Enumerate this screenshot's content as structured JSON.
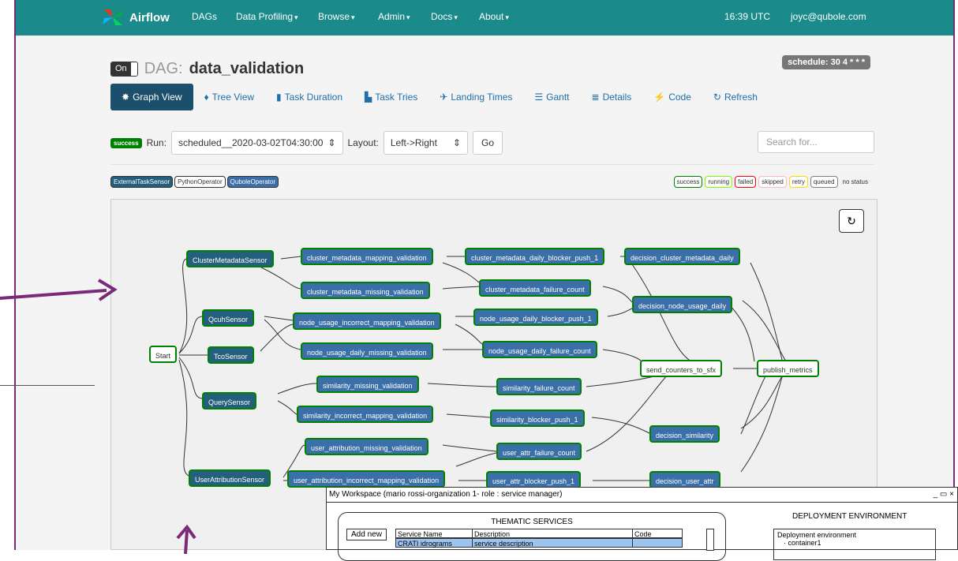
{
  "colors": {
    "navbar": "#1b8a8a",
    "success_border": "#008000",
    "sensor_node": "#255f7e",
    "qubole_node": "#3a6fa8",
    "annotation_arrow": "#7a2a7a"
  },
  "navbar": {
    "brand": "Airflow",
    "items": [
      {
        "label": "DAGs",
        "caret": false
      },
      {
        "label": "Data Profiling",
        "caret": true
      },
      {
        "label": "Browse",
        "caret": true
      },
      {
        "label": "Admin",
        "caret": true
      },
      {
        "label": "Docs",
        "caret": true
      },
      {
        "label": "About",
        "caret": true
      }
    ],
    "time": "16:39 UTC",
    "user": "joyc@qubole.com"
  },
  "header": {
    "toggle": "On",
    "dag_label": "DAG:",
    "dag_id": "data_validation",
    "schedule": "schedule: 30 4 * * *"
  },
  "tabs": [
    {
      "label": "Graph View",
      "icon": "asterisk-icon",
      "active": true
    },
    {
      "label": "Tree View",
      "icon": "tree-icon"
    },
    {
      "label": "Task Duration",
      "icon": "bar-chart-icon"
    },
    {
      "label": "Task Tries",
      "icon": "tries-chart-icon"
    },
    {
      "label": "Landing Times",
      "icon": "plane-icon"
    },
    {
      "label": "Gantt",
      "icon": "gantt-icon"
    },
    {
      "label": "Details",
      "icon": "list-icon"
    },
    {
      "label": "Code",
      "icon": "flash-icon"
    },
    {
      "label": "Refresh",
      "icon": "refresh-icon"
    }
  ],
  "runbar": {
    "status": "success",
    "run_label": "Run:",
    "run_value": "scheduled__2020-03-02T04:30:00",
    "layout_label": "Layout:",
    "layout_value": "Left->Right",
    "go": "Go",
    "search_placeholder": "Search for..."
  },
  "operators": [
    "ExternalTaskSensor",
    "PythonOperator",
    "QuboleOperator"
  ],
  "legend": [
    {
      "label": "success",
      "color": "#008000"
    },
    {
      "label": "running",
      "color": "#7cfc00"
    },
    {
      "label": "failed",
      "color": "#ff0000"
    },
    {
      "label": "skipped",
      "color": "#ffb6c1"
    },
    {
      "label": "retry",
      "color": "#ffd700"
    },
    {
      "label": "queued",
      "color": "#808080"
    },
    {
      "label": "no status",
      "color": null
    }
  ],
  "nodes": {
    "start": "Start",
    "cluster_metadata_sensor": "ClusterMetadataSensor",
    "qcuh_sensor": "QcuhSensor",
    "tco_sensor": "TcoSensor",
    "query_sensor": "QuerySensor",
    "user_attribution_sensor": "UserAttributionSensor",
    "cluster_metadata_mapping_validation": "cluster_metadata_mapping_validation",
    "cluster_metadata_missing_validation": "cluster_metadata_missing_validation",
    "node_usage_incorrect_mapping_validation": "node_usage_incorrect_mapping_validation",
    "node_usage_daily_missing_validation": "node_usage_daily_missing_validation",
    "similarity_missing_validation": "similarity_missing_validation",
    "similarity_incorrect_mapping_validation": "similarity_incorrect_mapping_validation",
    "user_attribution_missing_validation": "user_attribution_missing_validation",
    "user_attribution_incorrect_mapping_validation": "user_attribution_incorrect_mapping_validation",
    "cluster_metadata_daily_blocker_push_1": "cluster_metadata_daily_blocker_push_1",
    "cluster_metadata_failure_count": "cluster_metadata_failure_count",
    "node_usage_daily_blocker_push_1": "node_usage_daily_blocker_push_1",
    "node_usage_daily_failure_count": "node_usage_daily_failure_count",
    "similarity_failure_count": "similarity_failure_count",
    "similarity_blocker_push_1": "similarity_blocker_push_1",
    "user_attr_failure_count": "user_attr_failure_count",
    "user_attr_blocker_push_1": "user_attr_blocker_push_1",
    "decision_cluster_metadata_daily": "decision_cluster_metadata_daily",
    "decision_node_usage_daily": "decision_node_usage_daily",
    "decision_similarity": "decision_similarity",
    "decision_user_attr": "decision_user_attr",
    "send_counters_to_sfx": "send_counters_to_sfx",
    "publish_metrics": "publish_metrics"
  },
  "popup": {
    "title": "My Workspace (mario rossi-organization 1- role : service manager)",
    "thematic_title": "THEMATIC SERVICES",
    "add_new": "Add new",
    "columns": [
      "Service Name",
      "Description",
      "Code"
    ],
    "rows": [
      {
        "name": "CRATI idrograms",
        "description": "service description",
        "code": ""
      }
    ],
    "deploy_title": "DEPLOYMENT ENVIRONMENT",
    "deploy_lines": [
      "Deployment environment",
      "· container1"
    ]
  }
}
